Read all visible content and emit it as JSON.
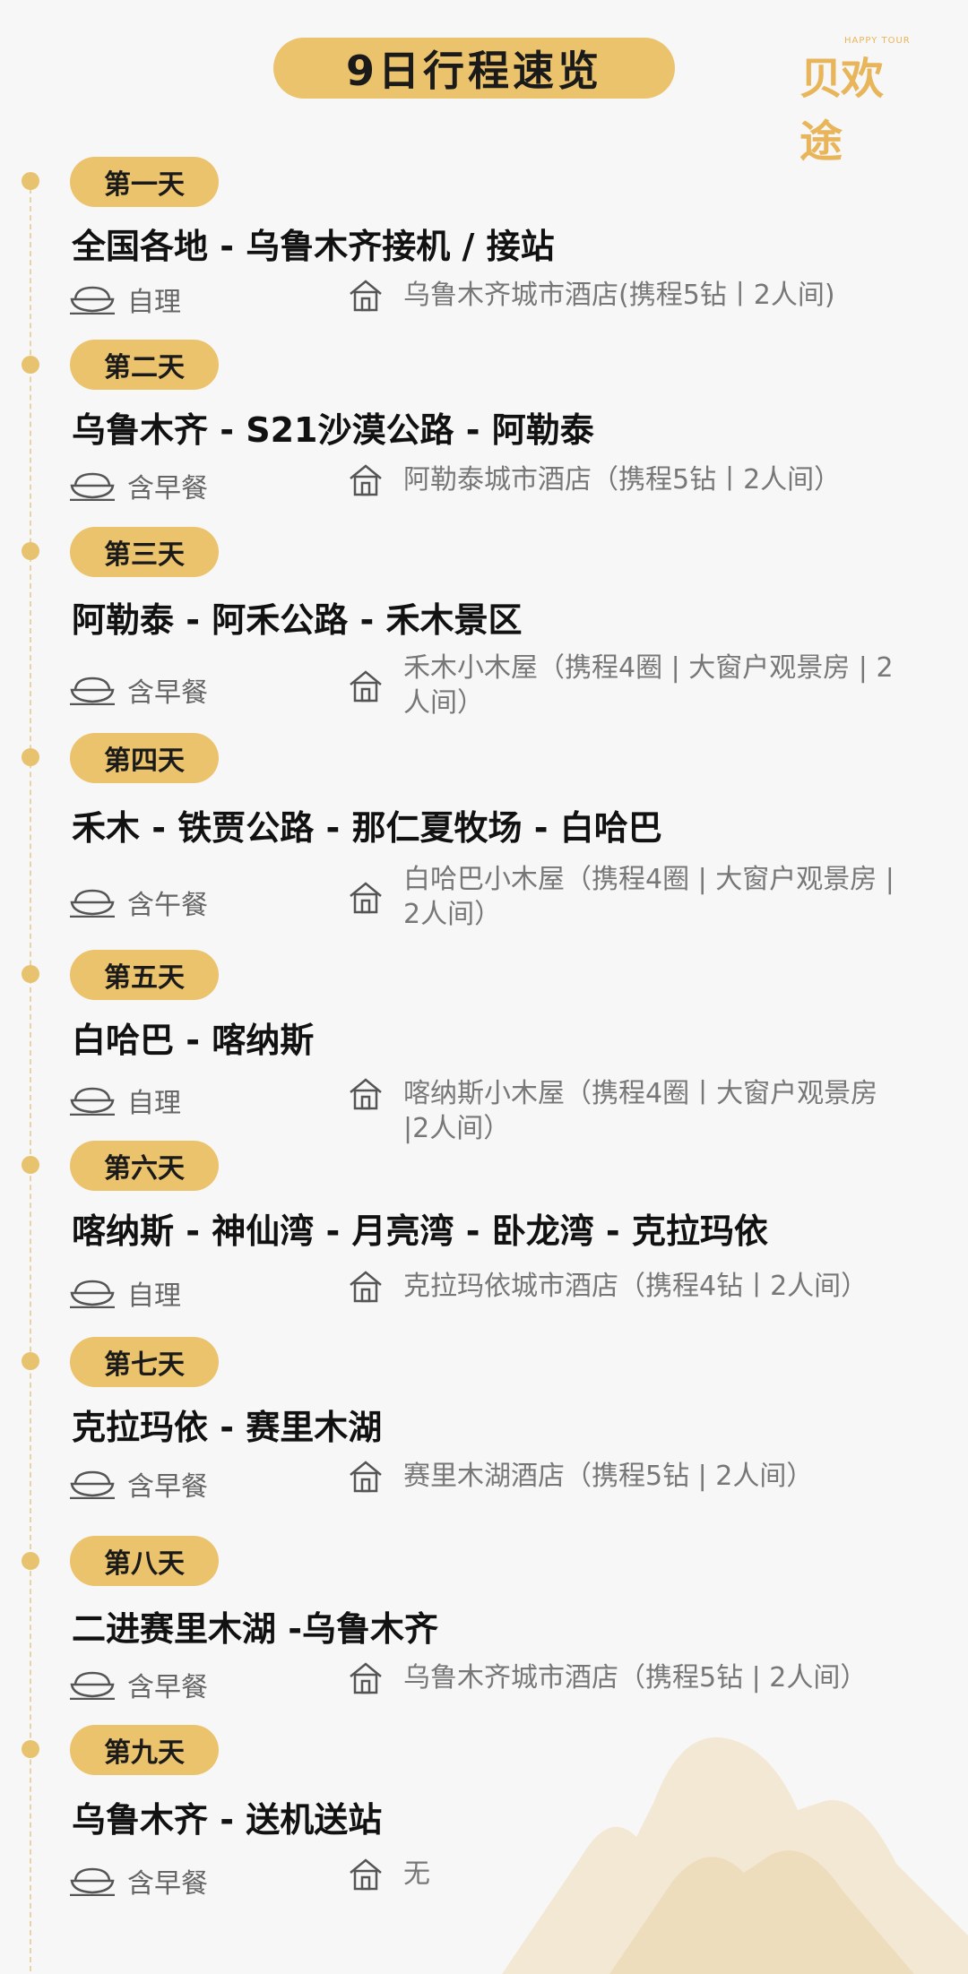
{
  "header": {
    "title": "9日行程速览"
  },
  "logo": {
    "main": "贝欢途",
    "sub": "HAPPY TOUR"
  },
  "days": [
    {
      "label": "第一天",
      "route": "全国各地 - 乌鲁木齐接机 / 接站",
      "meal": "自理",
      "hotel": "乌鲁木齐城市酒店(携程5钻丨2人间)"
    },
    {
      "label": "第二天",
      "route": "乌鲁木齐 - S21沙漠公路 - 阿勒泰",
      "meal": "含早餐",
      "hotel": "阿勒泰城市酒店（携程5钻丨2人间）"
    },
    {
      "label": "第三天",
      "route": "阿勒泰 - 阿禾公路 - 禾木景区",
      "meal": "含早餐",
      "hotel": "禾木小木屋（携程4圈 | 大窗户观景房 | 2人间）"
    },
    {
      "label": "第四天",
      "route": "禾木 - 铁贾公路 - 那仁夏牧场 - 白哈巴",
      "meal": "含午餐",
      "hotel": "白哈巴小木屋（携程4圈 | 大窗户观景房 | 2人间）"
    },
    {
      "label": "第五天",
      "route": "白哈巴 - 喀纳斯",
      "meal": "自理",
      "hotel": "喀纳斯小木屋（携程4圈丨大窗户观景房 |2人间）"
    },
    {
      "label": "第六天",
      "route": "喀纳斯 - 神仙湾 - 月亮湾 - 卧龙湾 - 克拉玛依",
      "meal": "自理",
      "hotel": "克拉玛依城市酒店（携程4钻丨2人间）"
    },
    {
      "label": "第七天",
      "route": "克拉玛依 - 赛里木湖",
      "meal": "含早餐",
      "hotel": "赛里木湖酒店（携程5钻 | 2人间）"
    },
    {
      "label": "第八天",
      "route": "二进赛里木湖 -乌鲁木齐",
      "meal": "含早餐",
      "hotel": "乌鲁木齐城市酒店（携程5钻 | 2人间）"
    },
    {
      "label": "第九天",
      "route": "乌鲁木齐 - 送机送站",
      "meal": "含早餐",
      "hotel": "无"
    }
  ],
  "icons": {
    "meal": "rice-bowl-icon",
    "hotel": "house-icon"
  },
  "colors": {
    "accent": "#ecc36d",
    "background": "#f7f7f7",
    "muted_text": "#777777"
  }
}
